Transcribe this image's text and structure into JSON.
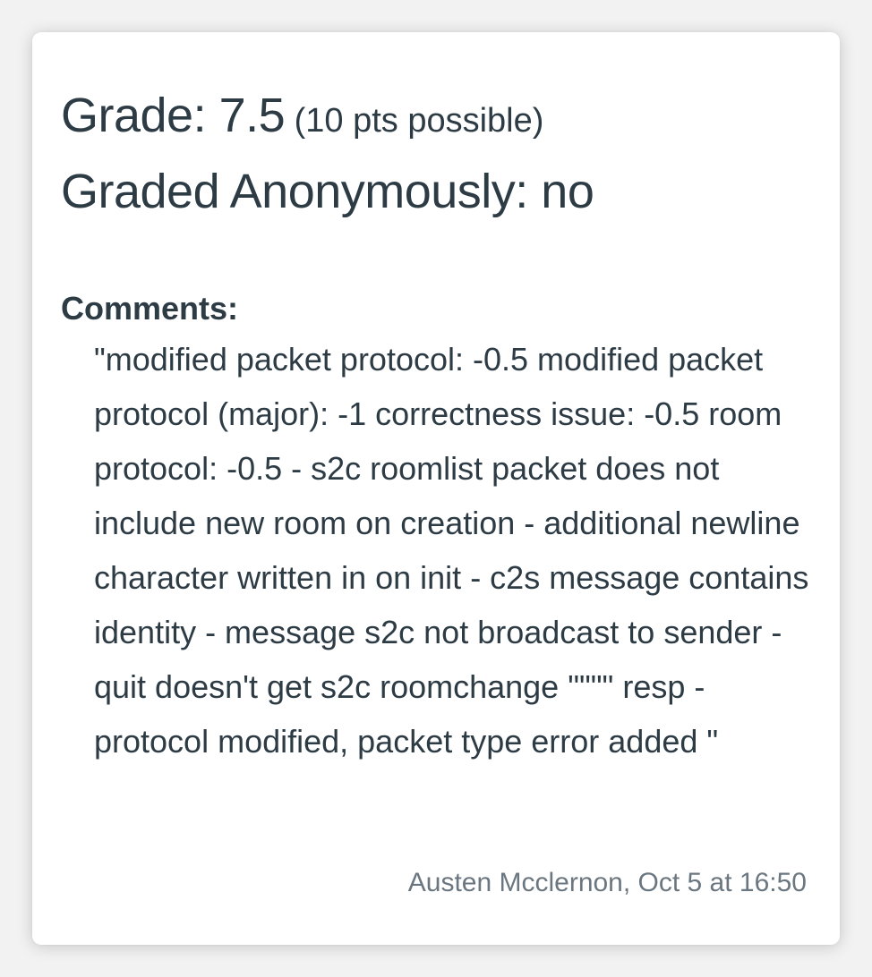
{
  "grade": {
    "label": "Grade: 7.5",
    "points_possible": "(10 pts possible)",
    "anonymous": "Graded Anonymously: no"
  },
  "comments": {
    "label": "Comments:",
    "text": "\"modified packet protocol: -0.5 modified packet protocol (major): -1 correctness issue: -0.5 room protocol: -0.5 - s2c roomlist packet does not include new room on creation - additional newline character written in on init - c2s message contains identity - message s2c not broadcast to sender - quit doesn't get s2c roomchange \"\"\"\" resp - protocol modified, packet type error added \"",
    "author": "Austen Mcclernon, Oct 5 at 16:50"
  },
  "colors": {
    "text": "#2d3b45",
    "muted": "#6b7780",
    "card_bg": "#ffffff",
    "page_bg": "#f2f2f2"
  }
}
